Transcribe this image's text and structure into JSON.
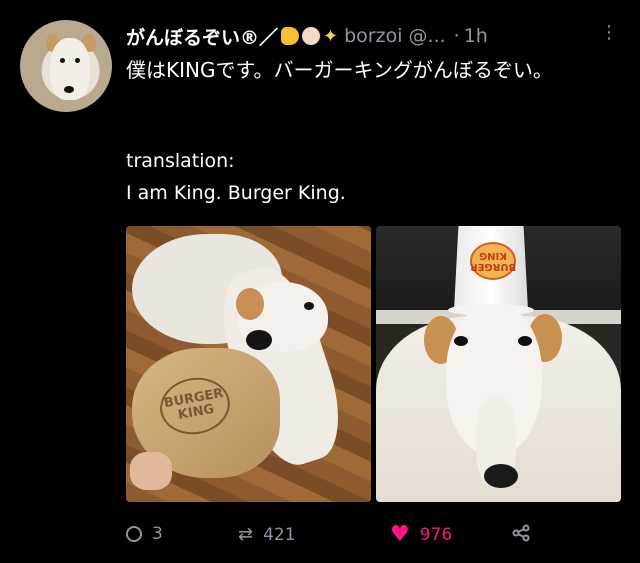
{
  "tweet": {
    "display_name": "がんぼるぞい®",
    "handle": "borzoi @...",
    "time": "1h",
    "text": "僕はKINGです。バーガーキングがんぼるぞい。",
    "translation_label": "translation:",
    "translation_text": "I am King. Burger King."
  },
  "images": {
    "left": {
      "logo_text": "BURGER KING"
    },
    "right": {
      "cup_text": "BURGER KING"
    }
  },
  "actions": {
    "replies": "3",
    "retweets": "421",
    "likes": "976"
  },
  "icons": {
    "reply": "reply-icon",
    "retweet": "retweet-icon",
    "like": "heart-icon",
    "share": "share-icon",
    "more": "more-icon"
  },
  "colors": {
    "background": "#000000",
    "text": "#ffffff",
    "muted": "#8b98a5",
    "like": "#f91880"
  }
}
